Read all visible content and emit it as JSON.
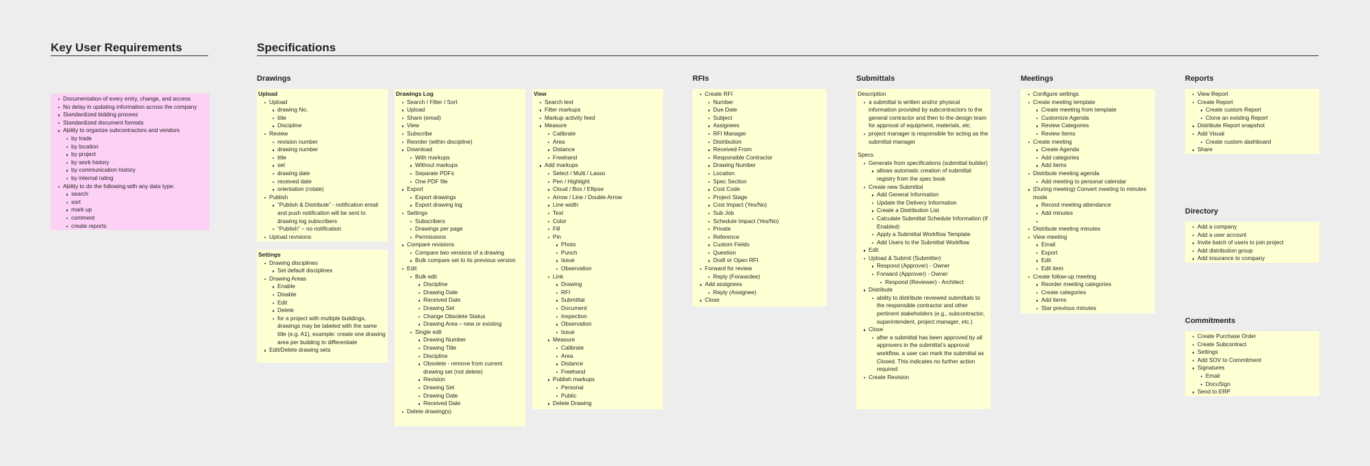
{
  "sections": {
    "kur": "Key User Requirements",
    "spec": "Specifications"
  },
  "groups": {
    "drawings": "Drawings",
    "rfis": "RFIs",
    "submittals": "Submittals",
    "meetings": "Meetings",
    "reports": "Reports",
    "directory": "Directory",
    "commitments": "Commitments"
  },
  "notes": {
    "kur": {
      "items": [
        {
          "t": "Documentation of every entry, change, and access"
        },
        {
          "t": "No delay in updating information across the company"
        },
        {
          "t": "Standardized bidding process"
        },
        {
          "t": "Standardized document formats"
        },
        {
          "t": "Ability to organize subcontractors and vendors",
          "c": [
            {
              "t": "by trade"
            },
            {
              "t": "by location"
            },
            {
              "t": "by project"
            },
            {
              "t": "by work history"
            },
            {
              "t": "by communication history"
            },
            {
              "t": "by internal rating"
            }
          ]
        },
        {
          "t": "Ability to do the following with any data type:",
          "c": [
            {
              "t": "search"
            },
            {
              "t": "sort"
            },
            {
              "t": "mark up"
            },
            {
              "t": "comment"
            },
            {
              "t": "create reports"
            }
          ]
        }
      ]
    },
    "upload": {
      "title": "Upload",
      "items": [
        {
          "t": "Upload",
          "c": [
            {
              "t": "drawing No."
            },
            {
              "t": "title"
            },
            {
              "t": "Discipline"
            }
          ]
        },
        {
          "t": "Review",
          "c": [
            {
              "t": "revision number"
            },
            {
              "t": "drawing number"
            },
            {
              "t": "title"
            },
            {
              "t": "set"
            },
            {
              "t": "drawing date"
            },
            {
              "t": "received date"
            },
            {
              "t": "orientation (rotate)"
            }
          ]
        },
        {
          "t": "Publish",
          "c": [
            {
              "t": "“Publish & Distribute” - notification email and push notification will be sent to drawing log subscribers"
            },
            {
              "t": "“Publish” – no notification"
            }
          ]
        },
        {
          "t": "Upload revisions"
        }
      ]
    },
    "settings": {
      "title": "Settings",
      "items": [
        {
          "t": "Drawing disciplines",
          "c": [
            {
              "t": "Set default disciplines"
            }
          ]
        },
        {
          "t": "Drawing Areas",
          "c": [
            {
              "t": "Enable"
            },
            {
              "t": "Disable"
            },
            {
              "t": "Edit"
            },
            {
              "t": "Delete"
            },
            {
              "t": "for a project with multiple buildings, drawings may be labeled with the same title (e.g. A1), example: create one drawing area per building to differentiate"
            }
          ]
        },
        {
          "t": "Edit/Delete drawing sets"
        }
      ]
    },
    "drawingslog": {
      "title": "Drawings Log",
      "items": [
        {
          "t": "Search / Filter / Sort"
        },
        {
          "t": "Upload"
        },
        {
          "t": "Share (email)"
        },
        {
          "t": "View"
        },
        {
          "t": "Subscribe"
        },
        {
          "t": "Reorder (within discipline)"
        },
        {
          "t": "Download",
          "c": [
            {
              "t": "With markups"
            },
            {
              "t": "Without markups"
            },
            {
              "t": "Separate PDFs"
            },
            {
              "t": "One PDF file"
            }
          ]
        },
        {
          "t": "Export",
          "c": [
            {
              "t": "Export drawings"
            },
            {
              "t": "Export drawing log"
            }
          ]
        },
        {
          "t": "Settings",
          "c": [
            {
              "t": "Subscribers"
            },
            {
              "t": "Drawings per page"
            },
            {
              "t": "Permissions"
            }
          ]
        },
        {
          "t": "Compare revisions",
          "c": [
            {
              "t": "Compare two versions of a drawing"
            },
            {
              "t": "Bulk compare set to its previous version"
            }
          ]
        },
        {
          "t": "Edit",
          "c": [
            {
              "t": "Bulk edit",
              "c": [
                {
                  "t": "Discipline"
                },
                {
                  "t": "Drawing Date"
                },
                {
                  "t": "Received Date"
                },
                {
                  "t": "Drawing Set"
                },
                {
                  "t": "Change Obsolete Status"
                },
                {
                  "t": "Drawing Area – new or existing"
                }
              ]
            },
            {
              "t": "Single edit",
              "c": [
                {
                  "t": "Drawing Number"
                },
                {
                  "t": "Drawing Title"
                },
                {
                  "t": "Discipline"
                },
                {
                  "t": "Obsolete - remove from current drawing set (not delete)"
                },
                {
                  "t": "Revision"
                },
                {
                  "t": "Drawing Set"
                },
                {
                  "t": "Drawing Date"
                },
                {
                  "t": "Received Date"
                }
              ]
            }
          ]
        },
        {
          "t": "Delete drawing(s)"
        }
      ]
    },
    "view": {
      "title": "View",
      "items": [
        {
          "t": "Search text"
        },
        {
          "t": "Filter markups"
        },
        {
          "t": "Markup activity feed"
        },
        {
          "t": "Measure",
          "c": [
            {
              "t": "Calibrate"
            },
            {
              "t": "Area"
            },
            {
              "t": "Distance"
            },
            {
              "t": "Freehand"
            }
          ]
        },
        {
          "t": "Add markups",
          "c": [
            {
              "t": "Select / Multi / Lasso"
            },
            {
              "t": "Pen / Highlight"
            },
            {
              "t": "Cloud / Box / Ellipse"
            },
            {
              "t": "Arrow / Line / Double Arrow"
            },
            {
              "t": "Line width"
            },
            {
              "t": "Text"
            },
            {
              "t": "Color"
            },
            {
              "t": "Fill"
            },
            {
              "t": "Pin",
              "c": [
                {
                  "t": "Photo"
                },
                {
                  "t": "Punch"
                },
                {
                  "t": "Issue"
                },
                {
                  "t": "Observation"
                }
              ]
            },
            {
              "t": "Link",
              "c": [
                {
                  "t": "Drawing"
                },
                {
                  "t": "RFI"
                },
                {
                  "t": "Submittal"
                },
                {
                  "t": "Document"
                },
                {
                  "t": "Inspection"
                },
                {
                  "t": "Observation"
                },
                {
                  "t": "Issue"
                }
              ]
            },
            {
              "t": "Measure",
              "c": [
                {
                  "t": "Calibrate"
                },
                {
                  "t": "Area"
                },
                {
                  "t": "Distance"
                },
                {
                  "t": "Freehand"
                }
              ]
            },
            {
              "t": "Publish markups",
              "c": [
                {
                  "t": "Personal"
                },
                {
                  "t": "Public"
                }
              ]
            },
            {
              "t": "Delete Drawing"
            }
          ]
        }
      ]
    },
    "rfis": {
      "items": [
        {
          "t": "Create RFI",
          "c": [
            {
              "t": "Number"
            },
            {
              "t": "Due Date"
            },
            {
              "t": "Subject"
            },
            {
              "t": "Assignees"
            },
            {
              "t": "RFI Manager"
            },
            {
              "t": "Distribution"
            },
            {
              "t": "Received From"
            },
            {
              "t": "Responsible Contractor"
            },
            {
              "t": "Drawing Number"
            },
            {
              "t": "Location"
            },
            {
              "t": "Spec Section"
            },
            {
              "t": "Cost Code"
            },
            {
              "t": "Project Stage"
            },
            {
              "t": "Cost Impact (Yes/No)"
            },
            {
              "t": "Sub Job"
            },
            {
              "t": "Schedule Impact (Yes/No)"
            },
            {
              "t": "Private"
            },
            {
              "t": "Reference"
            },
            {
              "t": "Custom Fields"
            },
            {
              "t": "Question"
            },
            {
              "t": "Draft or Open RFI"
            }
          ]
        },
        {
          "t": "Forward for review",
          "c": [
            {
              "t": "Reply (Forwardee)"
            }
          ]
        },
        {
          "t": "Add assignees",
          "c": [
            {
              "t": "Reply (Assignee)"
            }
          ]
        },
        {
          "t": "Close"
        }
      ]
    },
    "submittals": {
      "desc_label": "Description",
      "desc": [
        {
          "t": "a submittal is written and/or physical information provided by subcontractors to the general contractor and then to the design team for approval of equipment, materials, etc."
        },
        {
          "t": "project manager is responsible for acting as the submittal manager"
        }
      ],
      "specs_label": "Specs",
      "specs": [
        {
          "t": "Generate from specifications (submittal builder)",
          "c": [
            {
              "t": "allows automatic creation of submittal registry from the spec book"
            }
          ]
        },
        {
          "t": "Create new Submittal",
          "c": [
            {
              "t": "Add General Information"
            },
            {
              "t": "Update the Delivery Information"
            },
            {
              "t": "Create a Distribution List"
            },
            {
              "t": "Calculate Submittal Schedule Information (If Enabled)"
            },
            {
              "t": "Apply a Submittal Workflow Template"
            },
            {
              "t": "Add Users to the Submittal Workflow"
            }
          ]
        },
        {
          "t": "Edit"
        },
        {
          "t": "Upload & Submit (Submitter)",
          "c": [
            {
              "t": "Respond (Approver) - Owner"
            },
            {
              "t": "Forward (Approver) - Owner",
              "c": [
                {
                  "t": "Respond (Reviewer) - Architect"
                }
              ]
            }
          ]
        },
        {
          "t": "Distribute",
          "c": [
            {
              "t": "ability to distribute reviewed submittals to the responsible contractor and other pertinent stakeholders (e.g., subcontractor, superintendent, project manager, etc.)"
            }
          ]
        },
        {
          "t": "Close",
          "c": [
            {
              "t": "after a submittal has been approved by all approvers in the submittal’s approval workflow, a user can mark the submittal as Closed. This indicates no further action required"
            }
          ]
        },
        {
          "t": "Create Revision"
        }
      ]
    },
    "meetings": {
      "items": [
        {
          "t": "Configure settings"
        },
        {
          "t": "Create meeting template",
          "c": [
            {
              "t": "Create meeting from template"
            },
            {
              "t": "Customize Agenda"
            },
            {
              "t": "Review Categories"
            },
            {
              "t": "Review Items"
            }
          ]
        },
        {
          "t": "Create meeting",
          "c": [
            {
              "t": "Create Agenda"
            },
            {
              "t": "Add categories"
            },
            {
              "t": "Add items"
            }
          ]
        },
        {
          "t": "Distribute meeting agenda",
          "c": [
            {
              "t": "Add meeting to personal calendar"
            }
          ]
        },
        {
          "t": "(During meeting) Convert meeting to minutes mode",
          "c": [
            {
              "t": "Record meeting attendance"
            },
            {
              "t": "Add minutes"
            },
            {
              "t": ""
            }
          ]
        },
        {
          "t": "Distribute meeting minutes"
        },
        {
          "t": "View meeting",
          "c": [
            {
              "t": "Email"
            },
            {
              "t": "Export"
            },
            {
              "t": "Edit"
            },
            {
              "t": "Edit item"
            }
          ]
        },
        {
          "t": "Create follow-up meeting",
          "c": [
            {
              "t": "Reorder meeting categories"
            },
            {
              "t": "Create categories"
            },
            {
              "t": "Add items"
            },
            {
              "t": "Star previous minutes"
            }
          ]
        }
      ]
    },
    "reports": {
      "items": [
        {
          "t": "View Report"
        },
        {
          "t": "Create Report",
          "c": [
            {
              "t": "Create custom Report"
            },
            {
              "t": "Clone an existing Report"
            }
          ]
        },
        {
          "t": "Distribute Report snapshot"
        },
        {
          "t": "Add Visual",
          "c": [
            {
              "t": "Create custom dashboard"
            }
          ]
        },
        {
          "t": "Share"
        }
      ]
    },
    "directory": {
      "items": [
        {
          "t": "Add a company"
        },
        {
          "t": "Add a user account"
        },
        {
          "t": "Invite batch of users to join project"
        },
        {
          "t": "Add distribution group"
        },
        {
          "t": "Add insurance to company"
        }
      ]
    },
    "commitments": {
      "items": [
        {
          "t": "Create Purchase Order"
        },
        {
          "t": "Create Subcontract"
        },
        {
          "t": "Settings"
        },
        {
          "t": "Add SOV to Commitment"
        },
        {
          "t": "Signatures",
          "c": [
            {
              "t": "Email"
            },
            {
              "t": "DocuSign"
            }
          ]
        },
        {
          "t": "Send to ERP"
        }
      ]
    }
  }
}
